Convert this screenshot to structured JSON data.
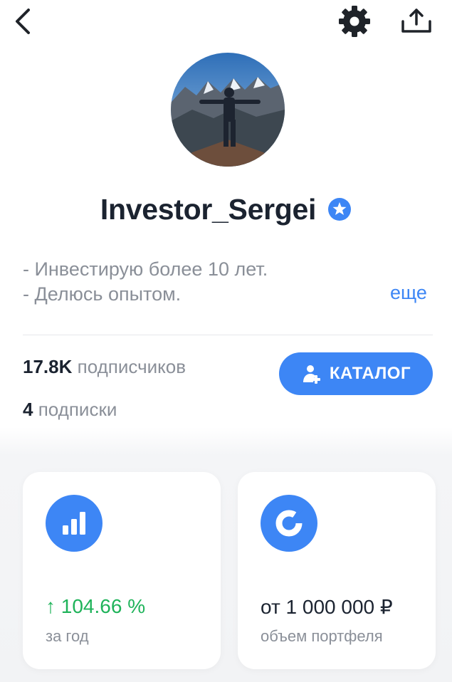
{
  "topbar": {
    "back_icon": "chevron-left-icon",
    "settings_icon": "gear-icon",
    "share_icon": "share-upload-icon"
  },
  "profile": {
    "username": "Investor_Sergei",
    "verified_icon": "star-badge-icon",
    "bio_lines": [
      "- Инвестирую более 10 лет.",
      "- Делюсь опытом."
    ],
    "more_link": "еще"
  },
  "stats": {
    "followers_count": "17.8K",
    "followers_label": "подписчиков",
    "following_count": "4",
    "following_label": "подписки"
  },
  "catalog_button": {
    "label": "КАТАЛОГ",
    "icon": "add-user-icon"
  },
  "cards": [
    {
      "icon": "bar-chart-icon",
      "value": "↑ 104.66 %",
      "label": "за год",
      "value_color": "#1fb35a"
    },
    {
      "icon": "donut-chart-icon",
      "value": "от 1 000 000 ₽",
      "label": "объем портфеля"
    }
  ],
  "colors": {
    "accent": "#3d86f5",
    "positive": "#1fb35a",
    "text_primary": "#1b2330",
    "text_secondary": "#8a8f98"
  }
}
